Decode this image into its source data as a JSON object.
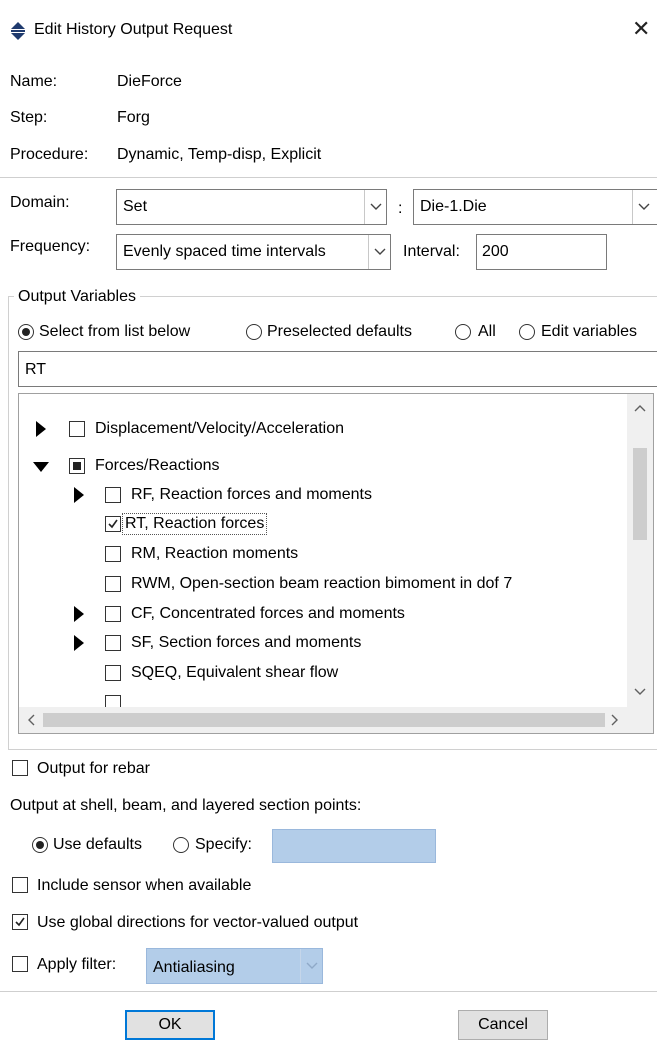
{
  "window": {
    "title": "Edit History Output Request",
    "close_glyph": "✕"
  },
  "info": {
    "name_label": "Name:",
    "name_value": "DieForce",
    "step_label": "Step:",
    "step_value": "Forg",
    "procedure_label": "Procedure:",
    "procedure_value": "Dynamic, Temp-disp, Explicit"
  },
  "domain": {
    "label": "Domain:",
    "type_value": "Set",
    "colon": ":",
    "set_value": "Die-1.Die"
  },
  "frequency": {
    "label": "Frequency:",
    "value": "Evenly spaced time intervals",
    "interval_label": "Interval:",
    "interval_value": "200"
  },
  "output_variables": {
    "legend": "Output Variables",
    "radio_options": [
      "Select from list below",
      "Preselected defaults",
      "All",
      "Edit variables"
    ],
    "selected_radio": "Select from list below",
    "variables_text": "RT",
    "tree": [
      {
        "label": "Displacement/Velocity/Acceleration",
        "expander": "collapsed",
        "state": "unchecked"
      },
      {
        "label": "Forces/Reactions",
        "expander": "expanded",
        "state": "partial"
      },
      {
        "label": "RF, Reaction forces and moments",
        "expander": "collapsed",
        "state": "unchecked"
      },
      {
        "label": "RT, Reaction forces",
        "expander": "none",
        "state": "checked"
      },
      {
        "label": "RM, Reaction moments",
        "expander": "none",
        "state": "unchecked"
      },
      {
        "label": "RWM, Open-section beam reaction bimoment in dof 7",
        "expander": "none",
        "state": "unchecked"
      },
      {
        "label": "CF, Concentrated forces and moments",
        "expander": "collapsed",
        "state": "unchecked"
      },
      {
        "label": "SF, Section forces and moments",
        "expander": "collapsed",
        "state": "unchecked"
      },
      {
        "label": "SQEQ, Equivalent shear flow",
        "expander": "none",
        "state": "unchecked"
      }
    ]
  },
  "rebar": {
    "label": "Output for rebar",
    "checked": false
  },
  "section_points": {
    "label": "Output at shell, beam, and layered section points:",
    "use_defaults_label": "Use defaults",
    "specify_label": "Specify:",
    "selected": "Use defaults",
    "specify_value": ""
  },
  "sensor": {
    "label": "Include sensor when available",
    "checked": false
  },
  "global_dirs": {
    "label": "Use global directions for vector-valued output",
    "checked": true
  },
  "filter": {
    "label": "Apply filter:",
    "checked": false,
    "value": "Antialiasing"
  },
  "buttons": {
    "ok": "OK",
    "cancel": "Cancel"
  },
  "colors": {
    "disabled_field": "#b3cde9",
    "accent": "#0078d7"
  }
}
